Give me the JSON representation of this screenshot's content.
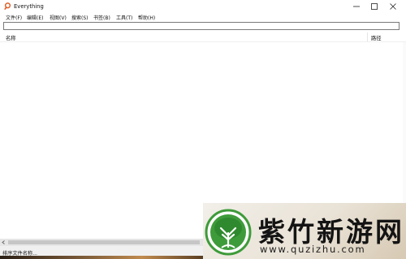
{
  "window": {
    "title": "Everything",
    "controls": {
      "minimize": "minimize",
      "maximize": "maximize",
      "close": "close"
    }
  },
  "menu": {
    "items": [
      "文件(F)",
      "编辑(E)",
      "视图(V)",
      "搜索(S)",
      "书签(B)",
      "工具(T)",
      "帮助(H)"
    ]
  },
  "search": {
    "value": "",
    "placeholder": ""
  },
  "columns": {
    "name": "名称",
    "path": "路径"
  },
  "status": {
    "text": "排序文件名称..."
  },
  "watermark": {
    "title": "紫竹新游网",
    "url": "www.quzizhu.com"
  },
  "colors": {
    "logo_green": "#3e9b3a",
    "logo_dark": "#1f6b23",
    "app_icon": "#e0602a"
  }
}
